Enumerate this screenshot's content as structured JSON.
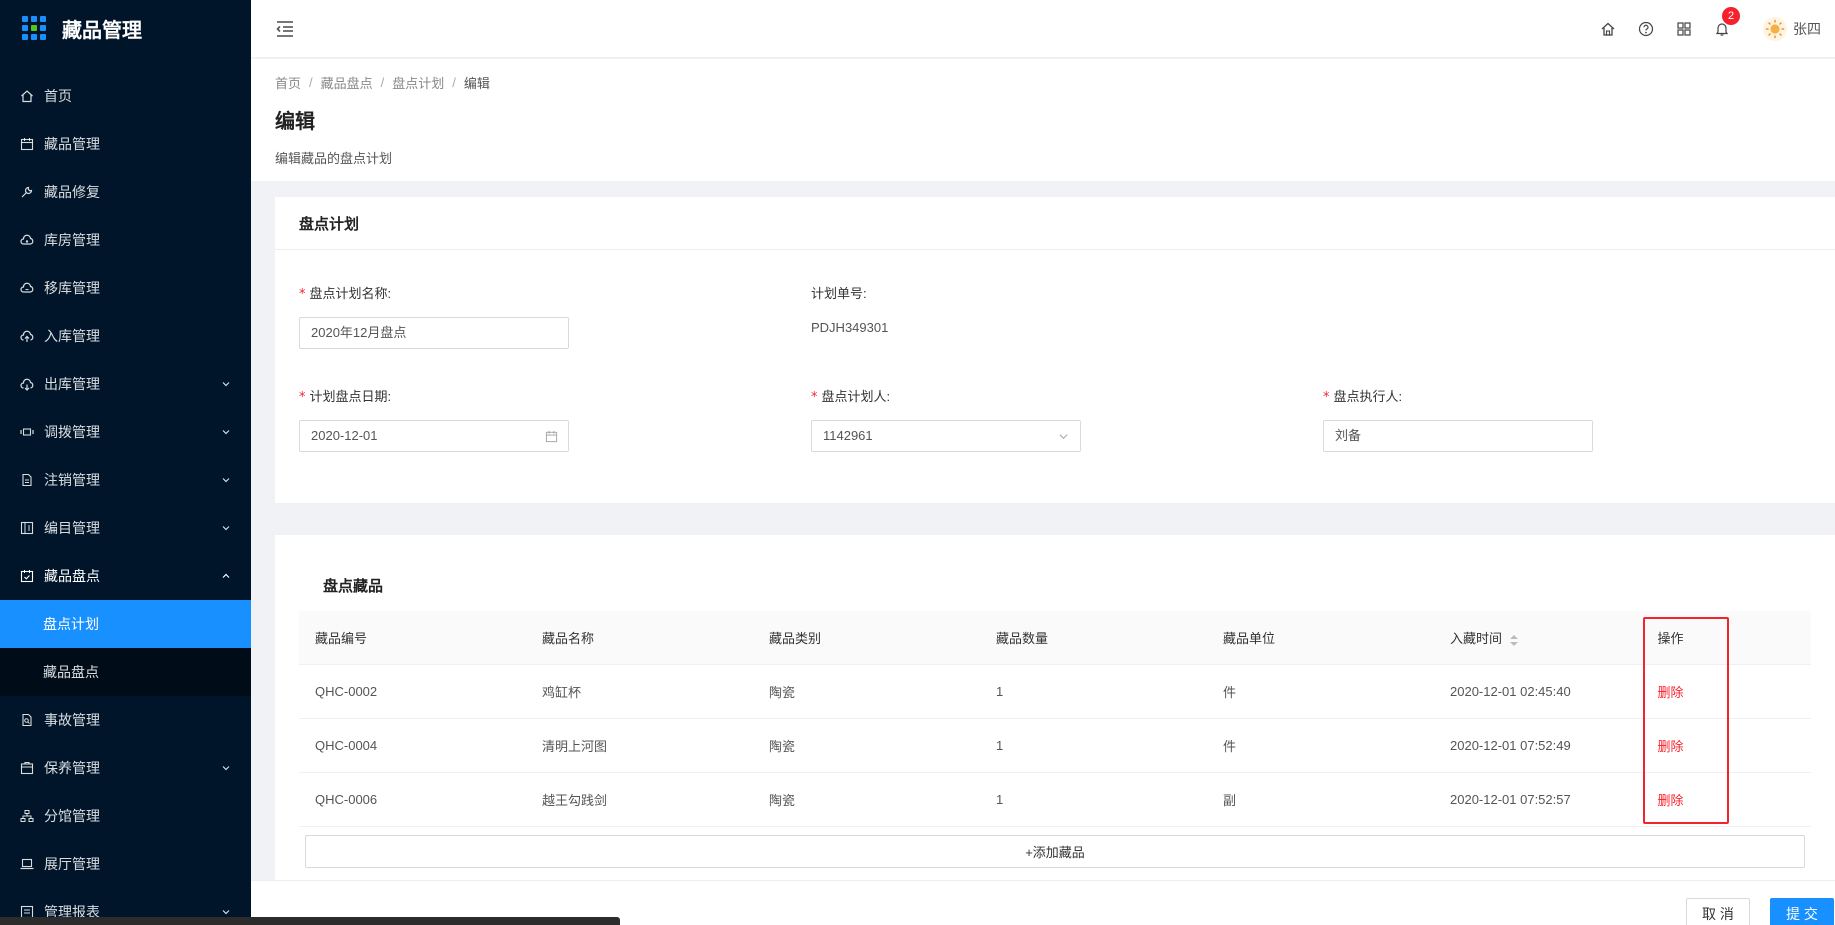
{
  "app": {
    "title": "藏品管理"
  },
  "sidebar": {
    "items": [
      {
        "label": "首页",
        "icon": "home-icon",
        "has_children": false
      },
      {
        "label": "藏品管理",
        "icon": "calendar-icon",
        "has_children": false
      },
      {
        "label": "藏品修复",
        "icon": "wrench-icon",
        "has_children": false
      },
      {
        "label": "库房管理",
        "icon": "cloud-icon",
        "has_children": false
      },
      {
        "label": "移库管理",
        "icon": "cloud-sync-icon",
        "has_children": false
      },
      {
        "label": "入库管理",
        "icon": "cloud-upload-icon",
        "has_children": false
      },
      {
        "label": "出库管理",
        "icon": "cloud-download-icon",
        "has_children": true
      },
      {
        "label": "调拨管理",
        "icon": "transfer-icon",
        "has_children": true
      },
      {
        "label": "注销管理",
        "icon": "file-icon",
        "has_children": true
      },
      {
        "label": "编目管理",
        "icon": "catalog-icon",
        "has_children": true
      },
      {
        "label": "藏品盘点",
        "icon": "inventory-icon",
        "has_children": true,
        "open": true
      },
      {
        "label": "事故管理",
        "icon": "file-search-icon",
        "has_children": false
      },
      {
        "label": "保养管理",
        "icon": "box-icon",
        "has_children": true
      },
      {
        "label": "分馆管理",
        "icon": "cluster-icon",
        "has_children": false
      },
      {
        "label": "展厅管理",
        "icon": "laptop-icon",
        "has_children": false
      },
      {
        "label": "管理报表",
        "icon": "report-icon",
        "has_children": true
      }
    ],
    "submenu": [
      {
        "label": "盘点计划",
        "active": true
      },
      {
        "label": "藏品盘点",
        "active": false
      }
    ]
  },
  "header": {
    "notification_count": "2",
    "username": "张四"
  },
  "breadcrumb": [
    "首页",
    "藏品盘点",
    "盘点计划",
    "编辑"
  ],
  "page": {
    "title": "编辑",
    "description": "编辑藏品的盘点计划"
  },
  "plan_card": {
    "title": "盘点计划",
    "fields": {
      "plan_name": {
        "label": "盘点计划名称:",
        "value": "2020年12月盘点",
        "required": true
      },
      "plan_no": {
        "label": "计划单号:",
        "value": "PDJH349301",
        "required": false
      },
      "plan_date": {
        "label": "计划盘点日期:",
        "value": "2020-12-01",
        "required": true
      },
      "planner": {
        "label": "盘点计划人:",
        "value": "1142961",
        "required": true
      },
      "executor": {
        "label": "盘点执行人:",
        "value": "刘备",
        "required": true
      }
    }
  },
  "items_card": {
    "title": "盘点藏品",
    "columns": [
      "藏品编号",
      "藏品名称",
      "藏品类别",
      "藏品数量",
      "藏品单位",
      "入藏时间",
      "操作"
    ],
    "rows": [
      [
        "QHC-0002",
        "鸡缸杯",
        "陶瓷",
        "1",
        "件",
        "2020-12-01 02:45:40",
        "删除"
      ],
      [
        "QHC-0004",
        "清明上河图",
        "陶瓷",
        "1",
        "件",
        "2020-12-01 07:52:49",
        "删除"
      ],
      [
        "QHC-0006",
        "越王勾践剑",
        "陶瓷",
        "1",
        "副",
        "2020-12-01 07:52:57",
        "删除"
      ]
    ],
    "add_label": "+添加藏品"
  },
  "footer": {
    "cancel_label": "取 消",
    "submit_label": "提 交"
  },
  "colors": {
    "sidebar_bg": "#001529",
    "primary": "#1890ff",
    "danger": "#f5222d"
  }
}
